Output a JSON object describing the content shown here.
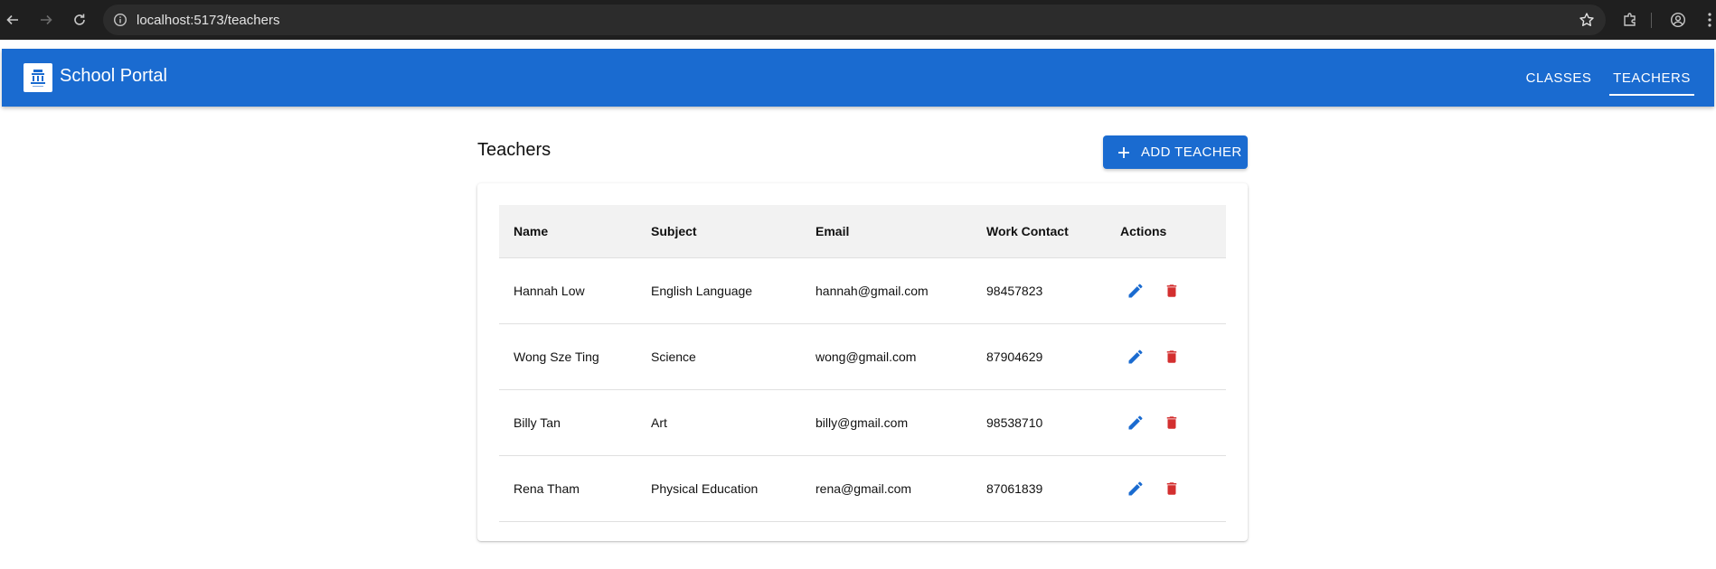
{
  "browser": {
    "url": "localhost:5173/teachers"
  },
  "appbar": {
    "brand": "School Portal",
    "nav": [
      {
        "label": "CLASSES",
        "active": false
      },
      {
        "label": "TEACHERS",
        "active": true
      }
    ]
  },
  "main": {
    "title": "Teachers",
    "add_button_label": "ADD TEACHER"
  },
  "table": {
    "columns": [
      "Name",
      "Subject",
      "Email",
      "Work Contact",
      "Actions"
    ],
    "rows": [
      {
        "name": "Hannah Low",
        "subject": "English Language",
        "email": "hannah@gmail.com",
        "contact": "98457823"
      },
      {
        "name": "Wong Sze Ting",
        "subject": "Science",
        "email": "wong@gmail.com",
        "contact": "87904629"
      },
      {
        "name": "Billy Tan",
        "subject": "Art",
        "email": "billy@gmail.com",
        "contact": "98538710"
      },
      {
        "name": "Rena Tham",
        "subject": "Physical Education",
        "email": "rena@gmail.com",
        "contact": "87061839"
      }
    ]
  },
  "colors": {
    "primary": "#1a6bd0",
    "delete": "#d32f2f",
    "edit": "#1a6bd0"
  },
  "icons": {
    "edit": "pencil-icon",
    "delete": "trash-icon",
    "add": "plus-icon"
  }
}
